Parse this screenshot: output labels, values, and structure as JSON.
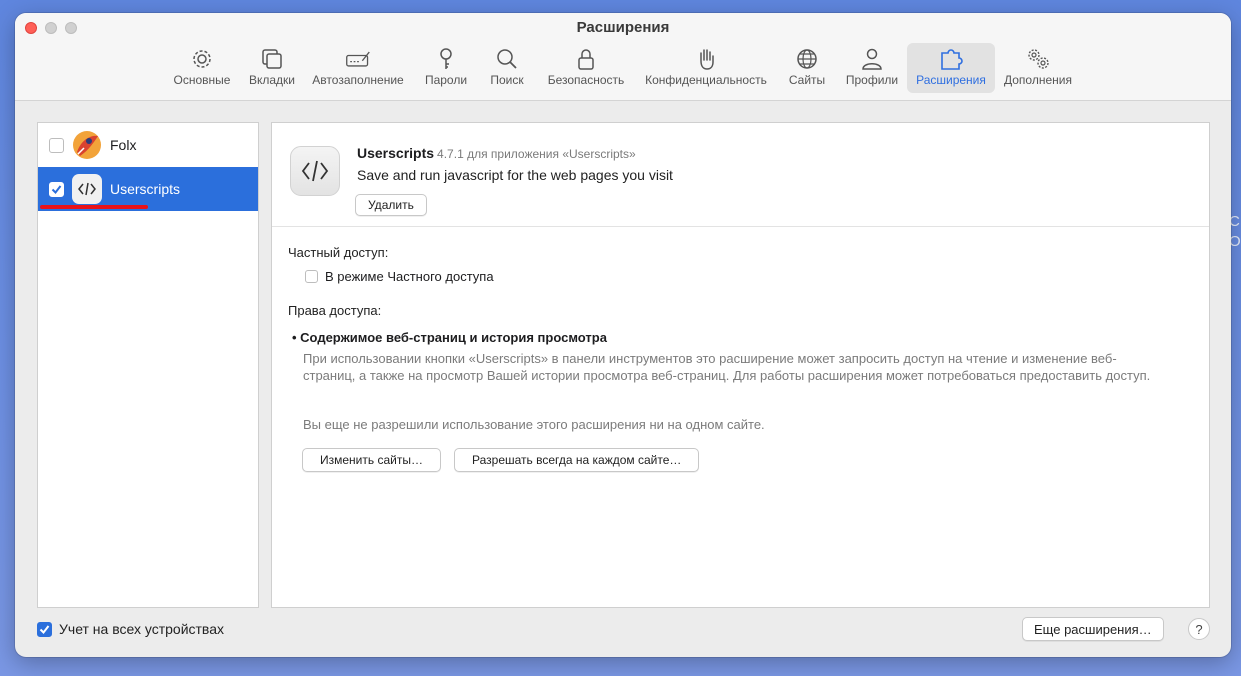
{
  "window": {
    "title": "Расширения"
  },
  "toolbar": {
    "items": [
      {
        "label": "Основные",
        "icon": "gear-icon"
      },
      {
        "label": "Вкладки",
        "icon": "tabs-icon"
      },
      {
        "label": "Автозаполнение",
        "icon": "autofill-icon"
      },
      {
        "label": "Пароли",
        "icon": "key-icon"
      },
      {
        "label": "Поиск",
        "icon": "search-icon"
      },
      {
        "label": "Безопасность",
        "icon": "lock-icon"
      },
      {
        "label": "Конфиденциальность",
        "icon": "hand-icon"
      },
      {
        "label": "Сайты",
        "icon": "globe-icon"
      },
      {
        "label": "Профили",
        "icon": "person-icon"
      },
      {
        "label": "Расширения",
        "icon": "extensions-icon",
        "active": true
      },
      {
        "label": "Дополнения",
        "icon": "gears-icon"
      }
    ]
  },
  "extensions": [
    {
      "name": "Folx",
      "enabled": false
    },
    {
      "name": "Userscripts",
      "enabled": true,
      "selected": true
    }
  ],
  "detail": {
    "name": "Userscripts",
    "version_text": "4.7.1 для приложения «Userscripts»",
    "description": "Save and run javascript for the web pages you visit",
    "delete_label": "Удалить",
    "private_access_label": "Частный доступ:",
    "private_mode_label": "В режиме Частного доступа",
    "permissions_label": "Права доступа:",
    "permission_title": "Содержимое веб-страниц и история просмотра",
    "permission_text": "При использовании кнопки «Userscripts» в панели инструментов это расширение может запросить доступ на чтение и изменение веб-страниц, а также на просмотр Вашей истории просмотра веб-страниц. Для работы расширения может потребоваться предоставить доступ.",
    "permission_note": "Вы еще не разрешили использование этого расширения ни на одном сайте.",
    "edit_sites_label": "Изменить сайты…",
    "allow_always_label": "Разрешать всегда на каждом сайте…"
  },
  "footer": {
    "sync_label": "Учет на всех устройствах",
    "more_label": "Еще расширения…",
    "help_label": "?"
  },
  "edge_text": "С\nОz",
  "colors": {
    "accent": "#2b6fdc",
    "close": "#ff5f57",
    "underline": "#e8121a"
  }
}
